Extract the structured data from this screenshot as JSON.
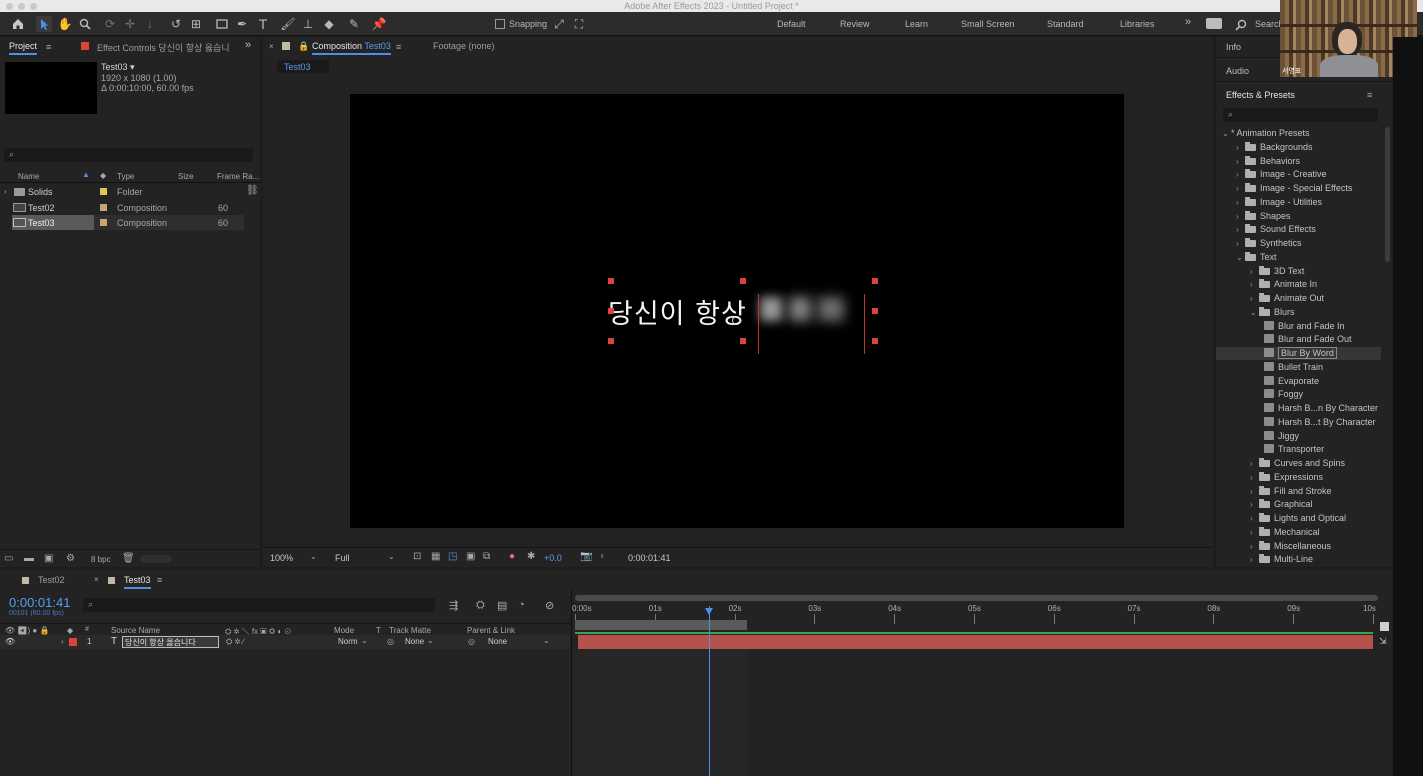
{
  "window": {
    "title": "Adobe After Effects 2023 - Untitled Project *"
  },
  "toolbar": {
    "snapping_label": "Snapping",
    "workspaces": [
      "Default",
      "Review",
      "Learn",
      "Small Screen",
      "Standard",
      "Libraries"
    ],
    "search_label": "Search"
  },
  "project_panel": {
    "tab_project": "Project",
    "tab_effect_controls": "Effect Controls 당신이 항상 옳습니",
    "item_name": "Test03 ▾",
    "item_res": "1920 x 1080 (1.00)",
    "item_duration": "Δ 0:00:10:00, 60.00 fps",
    "columns": [
      "Name",
      "Type",
      "Size",
      "Frame Ra..."
    ],
    "rows": [
      {
        "name": "Solids",
        "type": "Folder",
        "fps": ""
      },
      {
        "name": "Test02",
        "type": "Composition",
        "fps": "60"
      },
      {
        "name": "Test03",
        "type": "Composition",
        "fps": "60"
      }
    ],
    "bpc": "8 bpc"
  },
  "viewer": {
    "tab_composition": "Composition",
    "tab_comp_name": "Test03",
    "tab_footage": "Footage (none)",
    "comp_chip": "Test03",
    "canvas_text": "당신이 항상",
    "zoom": "100%",
    "resolution": "Full",
    "exposure": "+0.0",
    "timecode": "0:00:01:41"
  },
  "right_panel": {
    "info": "Info",
    "audio": "Audio",
    "effects_title": "Effects & Presets",
    "webcam_caption": "서영표",
    "tree": [
      {
        "label": "* Animation Presets",
        "level": 0,
        "kind": "root",
        "open": true
      },
      {
        "label": "Backgrounds",
        "level": 1,
        "kind": "folder"
      },
      {
        "label": "Behaviors",
        "level": 1,
        "kind": "folder"
      },
      {
        "label": "Image - Creative",
        "level": 1,
        "kind": "folder"
      },
      {
        "label": "Image - Special Effects",
        "level": 1,
        "kind": "folder"
      },
      {
        "label": "Image - Utilities",
        "level": 1,
        "kind": "folder"
      },
      {
        "label": "Shapes",
        "level": 1,
        "kind": "folder"
      },
      {
        "label": "Sound Effects",
        "level": 1,
        "kind": "folder"
      },
      {
        "label": "Synthetics",
        "level": 1,
        "kind": "folder"
      },
      {
        "label": "Text",
        "level": 1,
        "kind": "folder",
        "open": true
      },
      {
        "label": "3D Text",
        "level": 2,
        "kind": "folder"
      },
      {
        "label": "Animate In",
        "level": 2,
        "kind": "folder"
      },
      {
        "label": "Animate Out",
        "level": 2,
        "kind": "folder"
      },
      {
        "label": "Blurs",
        "level": 2,
        "kind": "folder",
        "open": true
      },
      {
        "label": "Blur and Fade In",
        "level": 3,
        "kind": "preset"
      },
      {
        "label": "Blur and Fade Out",
        "level": 3,
        "kind": "preset"
      },
      {
        "label": "Blur By Word",
        "level": 3,
        "kind": "preset",
        "selected": true
      },
      {
        "label": "Bullet Train",
        "level": 3,
        "kind": "preset"
      },
      {
        "label": "Evaporate",
        "level": 3,
        "kind": "preset"
      },
      {
        "label": "Foggy",
        "level": 3,
        "kind": "preset"
      },
      {
        "label": "Harsh B...n By Character",
        "level": 3,
        "kind": "preset"
      },
      {
        "label": "Harsh B...t By Character",
        "level": 3,
        "kind": "preset"
      },
      {
        "label": "Jiggy",
        "level": 3,
        "kind": "preset"
      },
      {
        "label": "Transporter",
        "level": 3,
        "kind": "preset"
      },
      {
        "label": "Curves and Spins",
        "level": 2,
        "kind": "folder"
      },
      {
        "label": "Expressions",
        "level": 2,
        "kind": "folder"
      },
      {
        "label": "Fill and Stroke",
        "level": 2,
        "kind": "folder"
      },
      {
        "label": "Graphical",
        "level": 2,
        "kind": "folder"
      },
      {
        "label": "Lights and Optical",
        "level": 2,
        "kind": "folder"
      },
      {
        "label": "Mechanical",
        "level": 2,
        "kind": "folder"
      },
      {
        "label": "Miscellaneous",
        "level": 2,
        "kind": "folder"
      },
      {
        "label": "Multi-Line",
        "level": 2,
        "kind": "folder"
      }
    ]
  },
  "timeline": {
    "tabs": [
      "Test02",
      "Test03"
    ],
    "timecode": "0:00:01:41",
    "frame_info": "00101 (60.00 fps)",
    "columns": {
      "source_name": "Source Name",
      "mode": "Mode",
      "t": "T",
      "track_matte": "Track Matte",
      "parent": "Parent & Link"
    },
    "layer": {
      "index": "1",
      "type": "T",
      "name": "당신이 항상 옳습니다",
      "mode": "Norm",
      "track_matte": "None",
      "parent": "None"
    },
    "ruler": [
      "0:00s",
      "01s",
      "02s",
      "03s",
      "04s",
      "05s",
      "06s",
      "07s",
      "08s",
      "09s",
      "10s"
    ],
    "playhead_seconds": 1.68,
    "work_area_end_seconds": 2.15,
    "duration_seconds": 10
  },
  "colors": {
    "accent": "#4d8ee8",
    "layer_bar": "#b5524b",
    "label_red": "#d8453d"
  }
}
